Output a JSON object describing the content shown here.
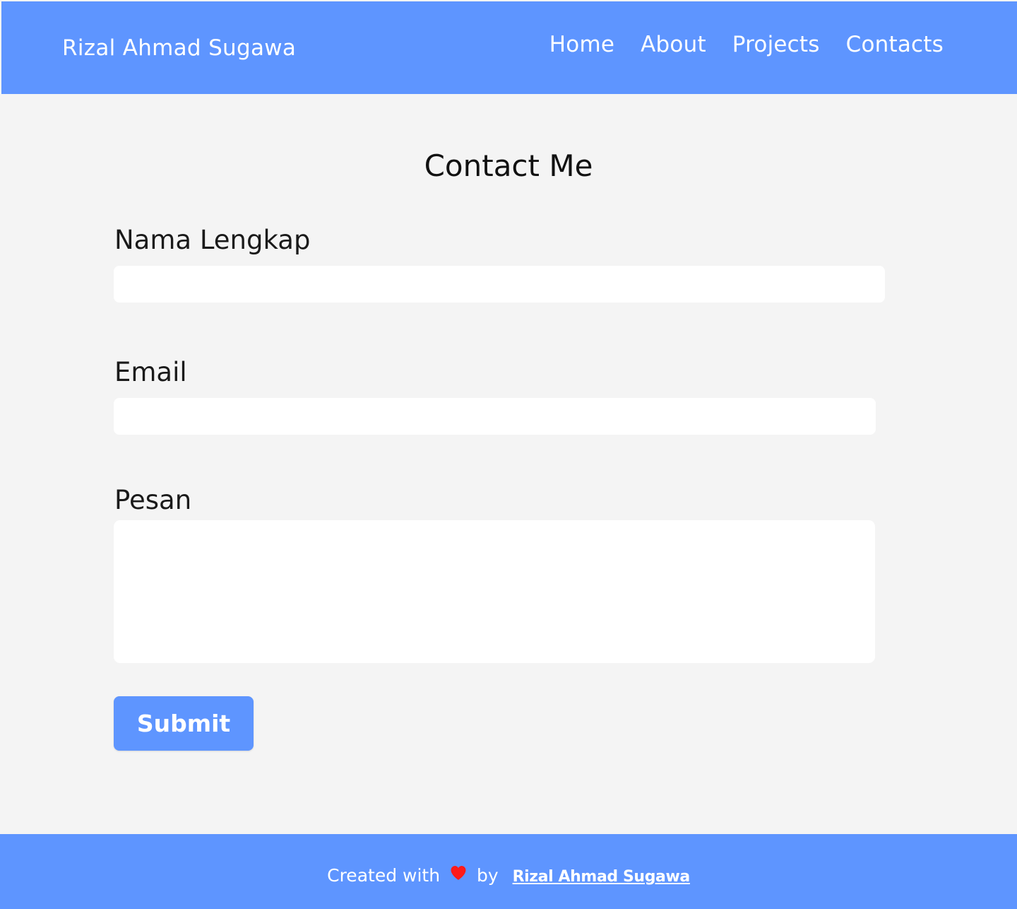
{
  "header": {
    "brand": "Rizal Ahmad Sugawa",
    "nav": [
      "Home",
      "About",
      "Projects",
      "Contacts"
    ]
  },
  "main": {
    "title": "Contact Me",
    "form": {
      "name_label": "Nama Lengkap",
      "name_value": "",
      "email_label": "Email",
      "email_value": "",
      "message_label": "Pesan",
      "message_value": "",
      "submit_label": "Submit"
    }
  },
  "footer": {
    "created_with": "Created with",
    "heart_icon": "heart-icon",
    "by": "by",
    "author": "Rizal Ahmad Sugawa"
  },
  "colors": {
    "accent": "#5e95ff",
    "background": "#f4f4f4",
    "heart": "#ff1a1a"
  }
}
